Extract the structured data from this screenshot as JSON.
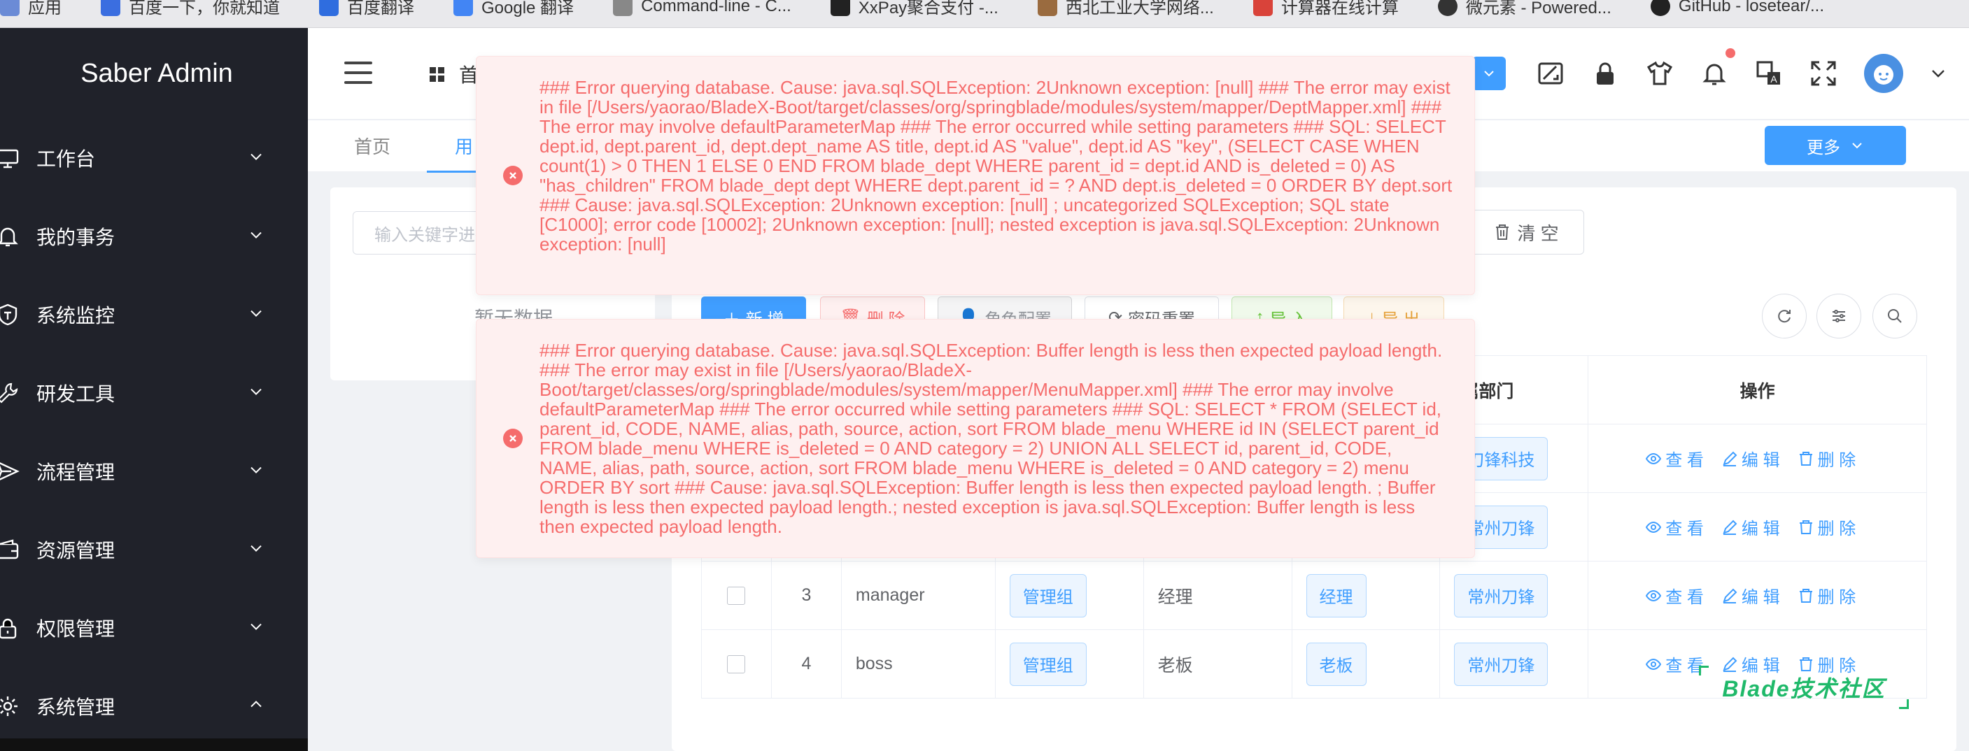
{
  "bookmarks": [
    {
      "label": "应用",
      "color": "#6b8bd6"
    },
    {
      "label": "百度一下，你就知道",
      "color": "#3b6ee0"
    },
    {
      "label": "百度翻译",
      "color": "#2f6ddf"
    },
    {
      "label": "Google 翻译",
      "color": "#4285f4"
    },
    {
      "label": "Command-line - C...",
      "color": "#888888"
    },
    {
      "label": "XxPay聚合支付 -...",
      "color": "#222222"
    },
    {
      "label": "西北工业大学网络...",
      "color": "#9a6b3f"
    },
    {
      "label": "计算器在线计算",
      "color": "#d9433a"
    },
    {
      "label": "微元素 - Powered...",
      "color": "#333333"
    },
    {
      "label": "GitHub - losetear/...",
      "color": "#222222"
    }
  ],
  "sidebar": {
    "title": "Saber Admin",
    "items": [
      {
        "label": "工作台",
        "icon": "monitor-icon",
        "expanded": false
      },
      {
        "label": "我的事务",
        "icon": "bell-icon",
        "expanded": false
      },
      {
        "label": "系统监控",
        "icon": "shield-icon",
        "expanded": false
      },
      {
        "label": "研发工具",
        "icon": "wrench-icon",
        "expanded": false
      },
      {
        "label": "流程管理",
        "icon": "send-icon",
        "expanded": false
      },
      {
        "label": "资源管理",
        "icon": "wallet-icon",
        "expanded": false
      },
      {
        "label": "权限管理",
        "icon": "lock-icon",
        "expanded": false
      },
      {
        "label": "系统管理",
        "icon": "gear-icon",
        "expanded": true
      }
    ]
  },
  "header": {
    "breadcrumb": "首",
    "icons": [
      "theme-toggle-icon",
      "screenshot-icon",
      "lock-icon",
      "shirt-icon",
      "bell-icon",
      "translate-icon",
      "fullscreen-icon",
      "avatar",
      "chevron-down-icon"
    ]
  },
  "tabs": {
    "items": [
      "首页",
      "用"
    ],
    "active_index": 1,
    "more_label": "更多"
  },
  "tree": {
    "search_placeholder": "输入关键字进行过滤",
    "empty_text": "暂无数据"
  },
  "toolbar": {
    "clear_label": "清 空",
    "buttons": [
      {
        "label": "新 增",
        "style": "primary"
      },
      {
        "label": "删 除",
        "style": "danger"
      },
      {
        "label": "角色配置",
        "style": "info"
      },
      {
        "label": "密码重置",
        "style": "default"
      },
      {
        "label": "导 入",
        "style": "success"
      },
      {
        "label": "导 出",
        "style": "warning"
      }
    ],
    "right_icons": [
      "refresh-icon",
      "column-settings-icon",
      "search-icon"
    ]
  },
  "table": {
    "headers": [
      "",
      "",
      "",
      "",
      "",
      "",
      "属部门",
      "操作"
    ],
    "rows": [
      {
        "index": "",
        "account": "",
        "tenant": "",
        "name": "",
        "role": "",
        "dept": "刀锋科技"
      },
      {
        "index": "",
        "account": "",
        "tenant": "",
        "name": "",
        "role": "",
        "dept": "常州刀锋"
      },
      {
        "index": "3",
        "account": "manager",
        "tenant": "管理组",
        "name": "经理",
        "role": "经理",
        "dept": "常州刀锋"
      },
      {
        "index": "4",
        "account": "boss",
        "tenant": "管理组",
        "name": "老板",
        "role": "老板",
        "dept": "常州刀锋"
      }
    ],
    "actions": {
      "view": "查 看",
      "edit": "编 辑",
      "delete": "删 除"
    }
  },
  "watermark": "Blade技术社区",
  "errors": [
    {
      "message": "### Error querying database. Cause: java.sql.SQLException: 2Unknown exception: [null] ### The error may exist in file [/Users/yaorao/BladeX-Boot/target/classes/org/springblade/modules/system/mapper/DeptMapper.xml] ### The error may involve defaultParameterMap ### The error occurred while setting parameters ### SQL: SELECT dept.id, dept.parent_id, dept.dept_name AS title, dept.id AS \"value\", dept.id AS \"key\", (SELECT CASE WHEN count(1) > 0 THEN 1 ELSE 0 END FROM blade_dept WHERE parent_id = dept.id AND is_deleted = 0) AS \"has_children\" FROM blade_dept dept WHERE dept.parent_id = ? AND dept.is_deleted = 0 ORDER BY dept.sort ### Cause: java.sql.SQLException: 2Unknown exception: [null] ; uncategorized SQLException; SQL state [C1000]; error code [10002]; 2Unknown exception: [null]; nested exception is java.sql.SQLException: 2Unknown exception: [null]"
    },
    {
      "message": "### Error querying database. Cause: java.sql.SQLException: Buffer length is less then expected payload length. ### The error may exist in file [/Users/yaorao/BladeX-Boot/target/classes/org/springblade/modules/system/mapper/MenuMapper.xml] ### The error may involve defaultParameterMap ### The error occurred while setting parameters ### SQL: SELECT * FROM (SELECT id, parent_id, CODE, NAME, alias, path, source, action, sort FROM blade_menu WHERE id IN (SELECT parent_id FROM blade_menu WHERE is_deleted = 0 AND category = 2) UNION ALL SELECT id, parent_id, CODE, NAME, alias, path, source, action, sort FROM blade_menu WHERE is_deleted = 0 AND category = 2) menu ORDER BY sort ### Cause: java.sql.SQLException: Buffer length is less then expected payload length. ; Buffer length is less then expected payload length.; nested exception is java.sql.SQLException: Buffer length is less then expected payload length."
    }
  ],
  "colors": {
    "primary": "#409eff",
    "danger": "#f56c6c",
    "success": "#67c23a",
    "warning": "#e6a23c",
    "sidebar_bg": "#20222a",
    "error_bg": "#fef0f0"
  }
}
